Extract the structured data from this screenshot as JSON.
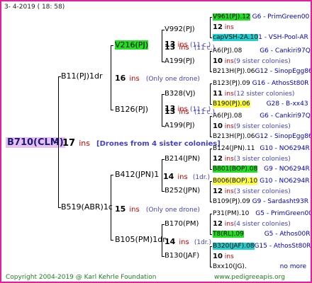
{
  "header": "3-  4-2019 ( 18: 58)",
  "root": {
    "name": "B710(CLM)",
    "count": "17",
    "ins": "ins",
    "note": "[Drones from 4 sister colonies]"
  },
  "gen1": [
    {
      "name": "B11(PJ)1dr",
      "count": "16",
      "ins": "ins",
      "note": "(Only one drone)"
    },
    {
      "name": "B519(ABR)1c",
      "count": "15",
      "ins": "ins",
      "note": "(Only one drone)"
    }
  ],
  "gen2": [
    {
      "name": "V216(PJ)",
      "count": "13",
      "ins": "ins",
      "note": "(11 c.)"
    },
    {
      "name": "B126(PJ)",
      "count": "13",
      "ins": "ins",
      "note": "(11 c.)"
    },
    {
      "name": "B412(JPN)1",
      "count": "14",
      "ins": "ins",
      "note": "(1dr.)"
    },
    {
      "name": "B105(PM)1dr",
      "count": "14",
      "ins": "ins",
      "note": "(1dr.)"
    }
  ],
  "gen3": [
    {
      "name": "V992(PJ)",
      "count": "13",
      "ins": "ins",
      "note": "(11 c.)"
    },
    {
      "name": "A199(PJ)"
    },
    {
      "name": "B328(VJ)",
      "count": "13",
      "ins": "ins",
      "note": "(11 c.)"
    },
    {
      "name": "A199(PJ)"
    },
    {
      "name": "B214(JPN)",
      "count": "14",
      "ins": "ins",
      "note": "(1dr.)"
    },
    {
      "name": "B252(JPN)"
    },
    {
      "name": "B170(PM)",
      "count": "14",
      "ins": "ins",
      "note": "(1dr.)"
    },
    {
      "name": "B130(JAF)"
    }
  ],
  "gen4": [
    {
      "name": "V961(PJ).12",
      "info": "G6 - PrimGreen00"
    },
    {
      "count": "12",
      "ins": "ins"
    },
    {
      "name": "capVSH-2A.10",
      "info": "1 - VSH-Pool-AR"
    },
    {
      "name": "A6(PJ).08",
      "info": "G6 - Cankiri97Q"
    },
    {
      "count": "10",
      "ins": "ins",
      "note": "(9 sister colonies)"
    },
    {
      "name": "B213H(PJ).06",
      "info": "G12 - SinopEgg86R"
    },
    {
      "name": "B123(PJ).09",
      "info": "G16 - AthosSt80R"
    },
    {
      "count": "11",
      "ins": "ins",
      "note": "(12 sister colonies)"
    },
    {
      "name": "B190(PJ).06",
      "info": "G28 - B-xx43"
    },
    {
      "name": "A6(PJ).08",
      "info": "G6 - Cankiri97Q"
    },
    {
      "count": "10",
      "ins": "ins",
      "note": "(9 sister colonies)"
    },
    {
      "name": "B213H(PJ).06",
      "info": "G12 - SinopEgg86R"
    },
    {
      "name": "B124(JPN).11",
      "info": "G10 - NO6294R"
    },
    {
      "count": "12",
      "ins": "ins",
      "note": "(3 sister colonies)"
    },
    {
      "name": "B801(BOP).08",
      "info": "G9 - NO6294R"
    },
    {
      "name": "B006(BOP).10",
      "info": "G10 - NO6294R"
    },
    {
      "count": "12",
      "ins": "ins",
      "note": "(3 sister colonies)"
    },
    {
      "name": "B109(PJ).09",
      "info": "G9 - Sardasht93R"
    },
    {
      "name": "P31(PM).10",
      "info": "G5 - PrimGreen00"
    },
    {
      "count": "12",
      "ins": "ins",
      "note": "(4 sister colonies)"
    },
    {
      "name": "T8(RL).09",
      "info": "G5 - Athos00R"
    },
    {
      "name": "B320(JAF).08",
      "info": "G15 - AthosSt80R"
    },
    {
      "count": "10",
      "ins": "ins"
    },
    {
      "name": "Bxx10(JG).",
      "info": "no more"
    }
  ],
  "footer": {
    "copyright": "Copyright 2004-2019 @ Karl Kehrle Foundation",
    "site": "www.pedigreeapis.org"
  }
}
